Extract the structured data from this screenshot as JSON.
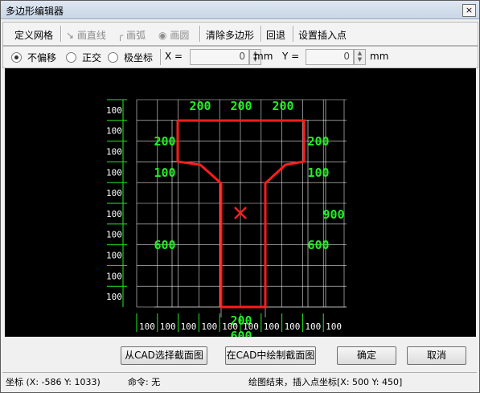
{
  "window": {
    "title": "多边形编辑器",
    "close_glyph": "×"
  },
  "toolbar": {
    "define_grid": "定义网格",
    "draw_line": "画直线",
    "draw_arc": "画弧",
    "draw_circle": "画圆",
    "clear_polygon": "清除多边形",
    "undo": "回退",
    "set_insert_point": "设置插入点"
  },
  "options": {
    "no_offset": "不偏移",
    "orthogonal": "正交",
    "polar": "极坐标",
    "x_label": "X =",
    "x_value": "0",
    "x_unit": "mm",
    "y_label": "Y =",
    "y_value": "0",
    "y_unit": "mm",
    "selected_mode": "不偏移"
  },
  "canvas": {
    "top_dims": [
      "200",
      "200",
      "200"
    ],
    "left_dims": [
      "200",
      "100",
      "600"
    ],
    "right_dims": [
      "200",
      "100",
      "600"
    ],
    "overall_right": "900",
    "web_width": "200",
    "bottom_total": "600",
    "row_labels": [
      "100",
      "100",
      "100",
      "100",
      "100",
      "100",
      "100",
      "100",
      "100",
      "100"
    ],
    "col_labels": [
      "100",
      "100",
      "100",
      "100",
      "100",
      "100",
      "100",
      "100",
      "100",
      "100"
    ],
    "colors": {
      "grid": "#ffffff",
      "dims": "#22ee22",
      "outline": "#ff1c1c",
      "marker": "#ff1c1c"
    }
  },
  "buttons": {
    "select_from_cad": "从CAD选择截面图",
    "draw_in_cad": "在CAD中绘制截面图",
    "ok": "确定",
    "cancel": "取消"
  },
  "status": {
    "coords": "坐标 (X: -586 Y: 1033)",
    "command": "命令: 无",
    "message": "绘图结束，插入点坐标[X: 500 Y: 450]"
  }
}
